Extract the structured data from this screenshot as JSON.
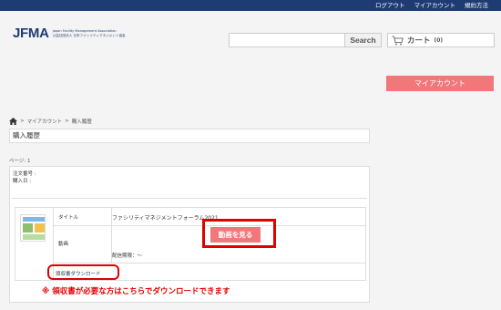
{
  "topbar": {
    "links": [
      "ログアウト",
      "マイアカウント",
      "規約方法"
    ]
  },
  "logo": {
    "mark": "JFMA",
    "line1": "Japan Facility Management Association",
    "line2": "公益社団法人 日本ファシリティマネジメント協会"
  },
  "search": {
    "placeholder": "",
    "button_label": "Search"
  },
  "cart": {
    "label": "カート",
    "count": "(0)"
  },
  "my_account_button": "マイアカウント",
  "breadcrumb": {
    "sep": ">",
    "items": [
      "マイアカウント",
      "購入履歴"
    ]
  },
  "page_title": "購入履歴",
  "pagination": "ページ: 1",
  "order": {
    "order_no_label": "注文番号 :",
    "purchase_date_label": "購入日 :",
    "item": {
      "title_label": "タイトル",
      "title_value": "ファシリティマネジメントフォーラム2021",
      "video_label": "動画",
      "video_button": "動画を見る",
      "delivery_period": "配信期限：〜",
      "receipt_link": "領収書ダウンロード"
    }
  },
  "note": "※ 領収書が必要な方はこちらでダウンロードできます",
  "colors": {
    "topbar": "#1f3b73",
    "accent_button": "#f2777a",
    "highlight": "#e00000"
  }
}
